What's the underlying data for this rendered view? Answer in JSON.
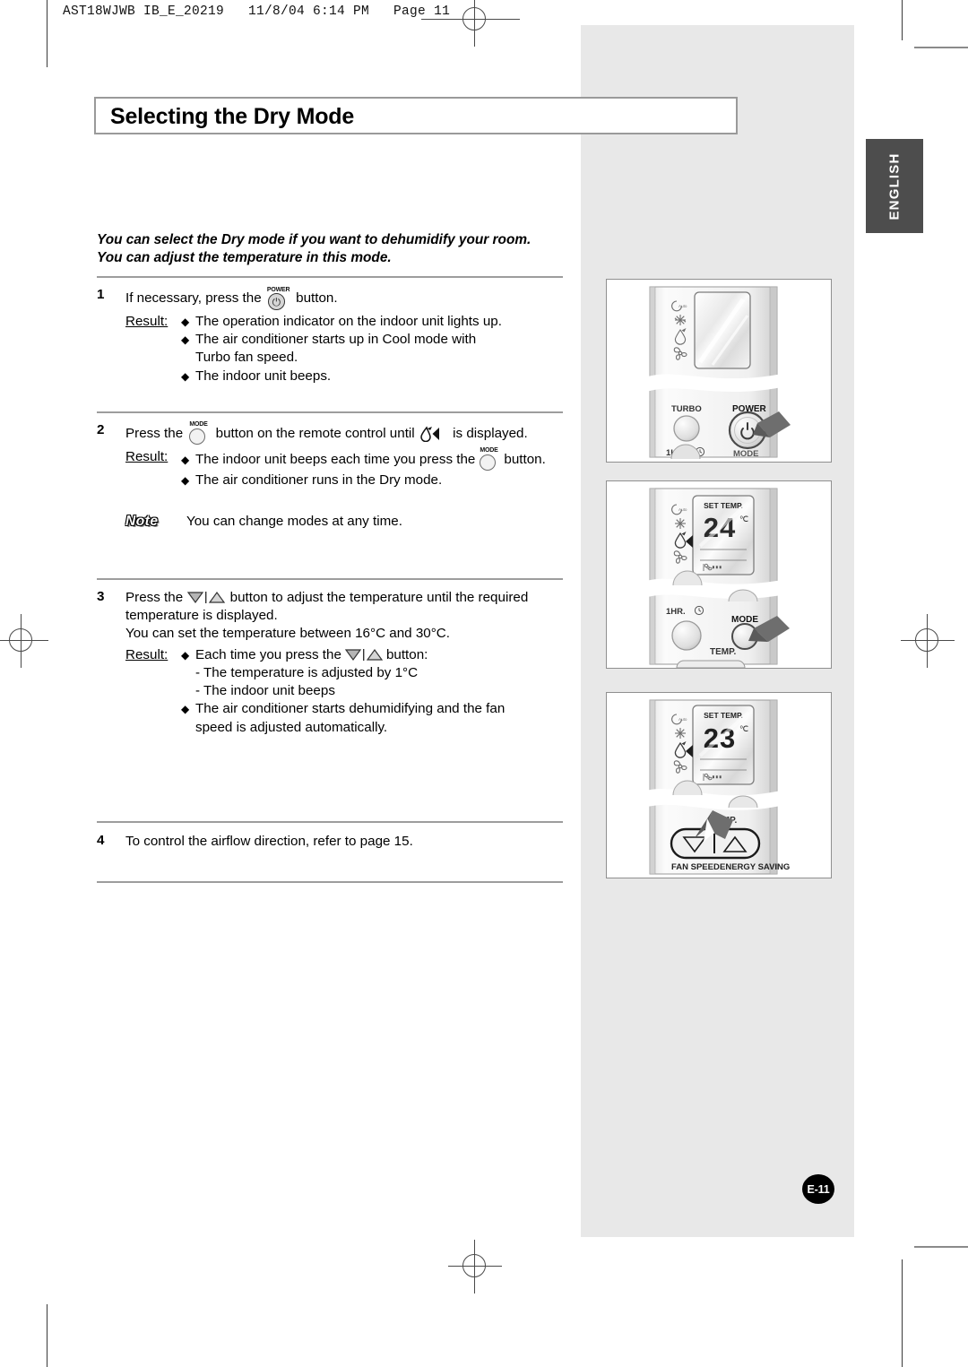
{
  "print_slug": "AST18WJWB IB_E_20219   11/8/04 6:14 PM   Page 11",
  "language_tab": "ENGLISH",
  "page_badge": "E-11",
  "title": "Selecting the Dry Mode",
  "intro": {
    "line1": "You can select the Dry mode if you want to dehumidify your room.",
    "line2": "You can adjust the temperature in this mode."
  },
  "result_label": "Result:",
  "steps": [
    {
      "num": "1",
      "lead_before": "If necessary, press the",
      "lead_after": "button.",
      "bullets": [
        {
          "text": "The operation indicator on the indoor unit lights up."
        },
        {
          "text": "The air conditioner starts up in Cool mode with",
          "cont": "Turbo fan speed."
        },
        {
          "text": "The indoor unit beeps."
        }
      ]
    },
    {
      "num": "2",
      "lead_before": "Press the",
      "lead_mid": "button on the remote control until",
      "lead_after": "is displayed.",
      "bullets": [
        {
          "text_before": "The indoor unit beeps each time you press the",
          "text_after": "button."
        },
        {
          "text": "The air conditioner runs in the Dry mode."
        }
      ]
    },
    {
      "num": "3",
      "lead_before": "Press the",
      "lead_after": "button to adjust the temperature until the required",
      "line2": "temperature is displayed.",
      "line3": "You can set the temperature between 16°C and 30°C.",
      "bullets": [
        {
          "text_before": "Each time you press the",
          "text_after": "button:",
          "sublines": [
            "- The temperature is adjusted by 1°C",
            "- The indoor unit beeps"
          ]
        },
        {
          "text": "The air conditioner starts dehumidifying and the fan",
          "cont": "speed is adjusted automatically."
        }
      ]
    },
    {
      "num": "4",
      "lead_before": "To control the airflow direction, refer to page 15."
    }
  ],
  "note": {
    "label": "Note",
    "text": "You can change modes at any time."
  },
  "illustrations": [
    {
      "id": "power-step",
      "mode_icons": [
        "Auto",
        "Cool",
        "Dry",
        "Fan"
      ],
      "auto_label": "Auto",
      "buttons": [
        "TURBO",
        "POWER",
        "1HR.",
        "MODE"
      ],
      "highlight": "POWER",
      "display": ""
    },
    {
      "id": "mode-step",
      "mode_icons": [
        "Auto",
        "Cool",
        "Dry",
        "Fan"
      ],
      "auto_label": "Auto",
      "display_caption": "SET TEMP.",
      "display_value": "24",
      "display_unit": "°C",
      "buttons": [
        "1HR.",
        "MODE",
        "TEMP."
      ],
      "highlight": "MODE"
    },
    {
      "id": "temp-step",
      "mode_icons": [
        "Auto",
        "Cool",
        "Dry",
        "Fan"
      ],
      "auto_label": "Auto",
      "display_caption": "SET TEMP.",
      "display_value": "23",
      "display_unit": "°C",
      "buttons": [
        "TEMP.",
        "FAN SPEED",
        "ENERGY SAVING"
      ],
      "highlight": "TEMP."
    }
  ],
  "colors": {
    "panel_gray": "#e8e8e8",
    "tab_gray": "#4d4d4d",
    "rule_gray": "#9d9d9d",
    "badge_black": "#000000"
  }
}
